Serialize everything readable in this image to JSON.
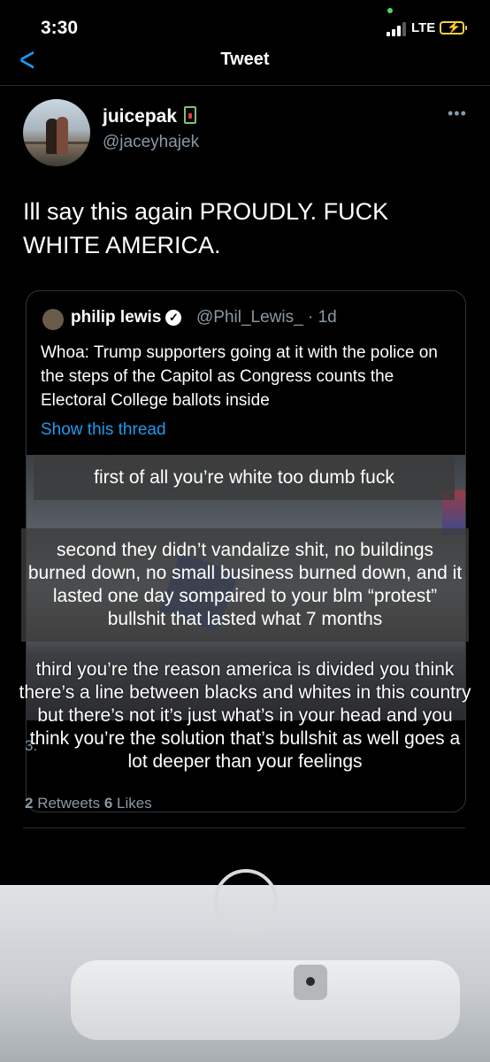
{
  "status_bar": {
    "time": "3:30",
    "network": "LTE"
  },
  "nav": {
    "back_icon": "chevron-left-icon",
    "title": "Tweet"
  },
  "tweet": {
    "display_name": "juicepak",
    "handle": "@jaceyhajek",
    "more_icon": "more-horizontal-icon",
    "text": "Ill say this again PROUDLY. FUCK WHITE AMERICA.",
    "meta": "3:",
    "retweets": "2",
    "retweets_label": "Retweets",
    "likes": "6",
    "likes_label": "Likes"
  },
  "quote": {
    "display_name": "philip lewis",
    "handle_time": "@Phil_Lewis_ · 1d",
    "text": "Whoa: Trump supporters going at it with the police on the steps of the Capitol as Congress counts the Electoral College ballots inside",
    "show_thread": "Show this thread"
  },
  "captions": {
    "first": "first of all you’re white too dumb fuck",
    "second": "second they didn’t vandalize shit, no buildings burned down, no small business burned down, and it lasted one day sompaired to your blm “protest” bullshit that lasted what 7 months",
    "third": "third you’re the reason america is divided you think there’s a line between blacks and whites in this country but there’s not it’s just what’s in your head and you think you’re the solution that’s bullshit as well goes a lot deeper than your feelings"
  },
  "colors": {
    "accent": "#1d9bf0",
    "background": "#000000",
    "muted": "#8b98a5",
    "battery": "#f4d04b"
  }
}
